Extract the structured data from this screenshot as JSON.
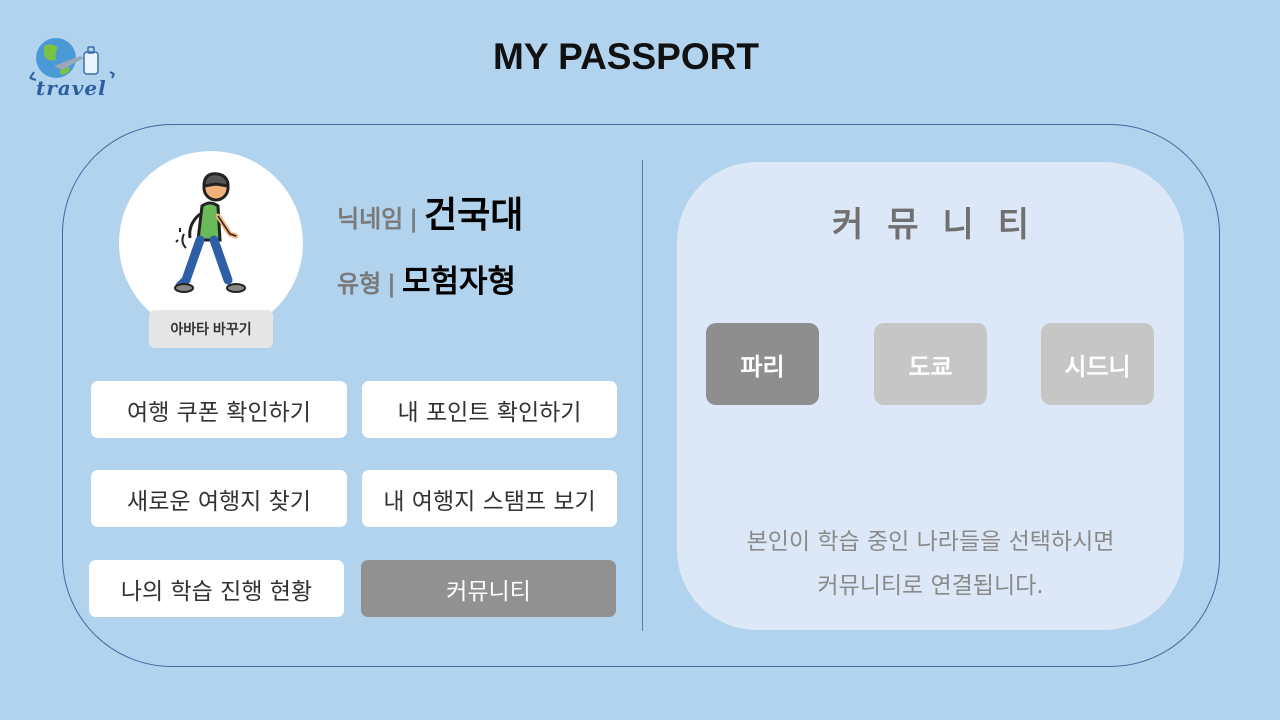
{
  "logo": {
    "text": "travel",
    "icon": "globe-airplane-suitcase-icon"
  },
  "page_title": "MY PASSPORT",
  "profile": {
    "avatar_button": "아바타 바꾸기",
    "nickname_label": "닉네임",
    "nickname_value": "건국대",
    "type_label": "유형",
    "type_value": "모험자형",
    "separator": "|"
  },
  "menu": [
    {
      "label": "여행 쿠폰 확인하기",
      "active": false
    },
    {
      "label": "내 포인트 확인하기",
      "active": false
    },
    {
      "label": "새로운 여행지 찾기",
      "active": false
    },
    {
      "label": "내 여행지 스탬프 보기",
      "active": false
    },
    {
      "label": "나의 학습 진행 현황",
      "active": false
    },
    {
      "label": "커뮤니티",
      "active": true
    }
  ],
  "community": {
    "title": "커뮤니티",
    "cities": [
      {
        "label": "파리",
        "selected": true
      },
      {
        "label": "도쿄",
        "selected": false
      },
      {
        "label": "시드니",
        "selected": false
      }
    ],
    "description_line1": "본인이 학습 중인 나라들을 선택하시면",
    "description_line2": "커뮤니티로 연결됩니다."
  },
  "colors": {
    "background": "#b2d3ee",
    "panel": "#dce8f7",
    "active_button": "#919191",
    "inactive_city": "#c6c6c6"
  }
}
